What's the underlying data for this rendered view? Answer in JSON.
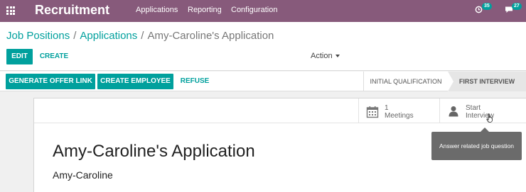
{
  "navbar": {
    "brand": "Recruitment",
    "menu": [
      "Applications",
      "Reporting",
      "Configuration"
    ],
    "activity_count": "35",
    "message_count": "27",
    "bg_color": "#875a7b"
  },
  "breadcrumb": {
    "items": [
      "Job Positions",
      "Applications"
    ],
    "active": "Amy-Caroline's Application",
    "separator": "/"
  },
  "toolbar": {
    "edit_label": "EDIT",
    "create_label": "CREATE",
    "action_label": "Action"
  },
  "header_buttons": {
    "generate_offer_label": "GENERATE OFFER LINK",
    "create_employee_label": "CREATE EMPLOYEE",
    "refuse_label": "REFUSE"
  },
  "stages": [
    "INITIAL QUALIFICATION",
    "FIRST INTERVIEW"
  ],
  "active_stage": "FIRST INTERVIEW",
  "smart_buttons": {
    "meetings_count": "1",
    "meetings_label": "Meetings",
    "start_line1": "Start",
    "start_line2": "Interview"
  },
  "tooltip": "Answer related job question",
  "form": {
    "title": "Amy-Caroline's Application",
    "partner": "Amy-Caroline"
  },
  "accent_color": "#00a09d"
}
